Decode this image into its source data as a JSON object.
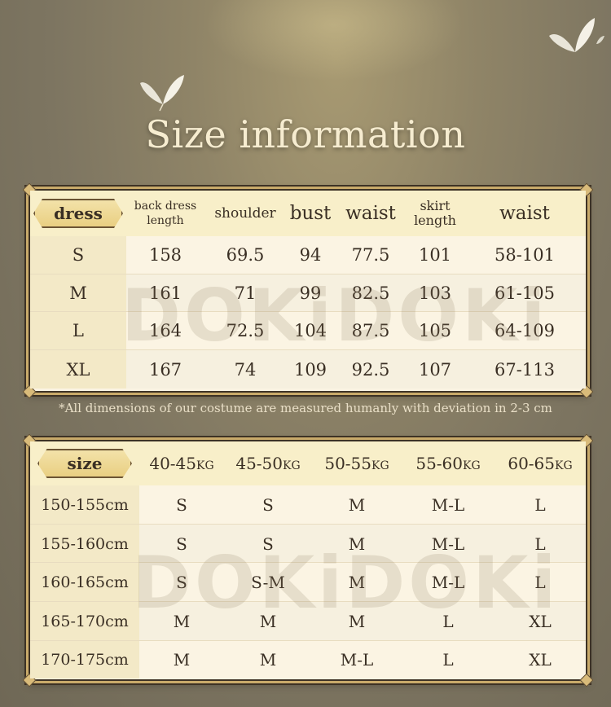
{
  "title": "Size information",
  "watermark": "DOKiDOKi",
  "dress_table": {
    "badge": "dress",
    "headers": [
      "back dress length",
      "shoulder",
      "bust",
      "waist",
      "skirt length",
      "waist"
    ],
    "rows": [
      {
        "size": "S",
        "values": [
          "158",
          "69.5",
          "94",
          "77.5",
          "101",
          "58-101"
        ]
      },
      {
        "size": "M",
        "values": [
          "161",
          "71",
          "99",
          "82.5",
          "103",
          "61-105"
        ]
      },
      {
        "size": "L",
        "values": [
          "164",
          "72.5",
          "104",
          "87.5",
          "105",
          "64-109"
        ]
      },
      {
        "size": "XL",
        "values": [
          "167",
          "74",
          "109",
          "92.5",
          "107",
          "67-113"
        ]
      }
    ]
  },
  "note": "*All dimensions of our costume are measured humanly with deviation in 2-3 cm",
  "size_table": {
    "badge": "size",
    "weight_unit": "KG",
    "weights": [
      "40-45",
      "45-50",
      "50-55",
      "55-60",
      "60-65"
    ],
    "rows": [
      {
        "height": "150-155cm",
        "values": [
          "S",
          "S",
          "M",
          "M-L",
          "L"
        ]
      },
      {
        "height": "155-160cm",
        "values": [
          "S",
          "S",
          "M",
          "M-L",
          "L"
        ]
      },
      {
        "height": "160-165cm",
        "values": [
          "S",
          "S-M",
          "M",
          "M-L",
          "L"
        ]
      },
      {
        "height": "165-170cm",
        "values": [
          "M",
          "M",
          "M",
          "L",
          "XL"
        ]
      },
      {
        "height": "170-175cm",
        "values": [
          "M",
          "M",
          "M-L",
          "L",
          "XL"
        ]
      }
    ]
  },
  "colors": {
    "panel": "#fbf4e3",
    "header": "#f8efc9",
    "badge": "#e9cf82",
    "text": "#3a2f24",
    "background": "#7d7561"
  }
}
